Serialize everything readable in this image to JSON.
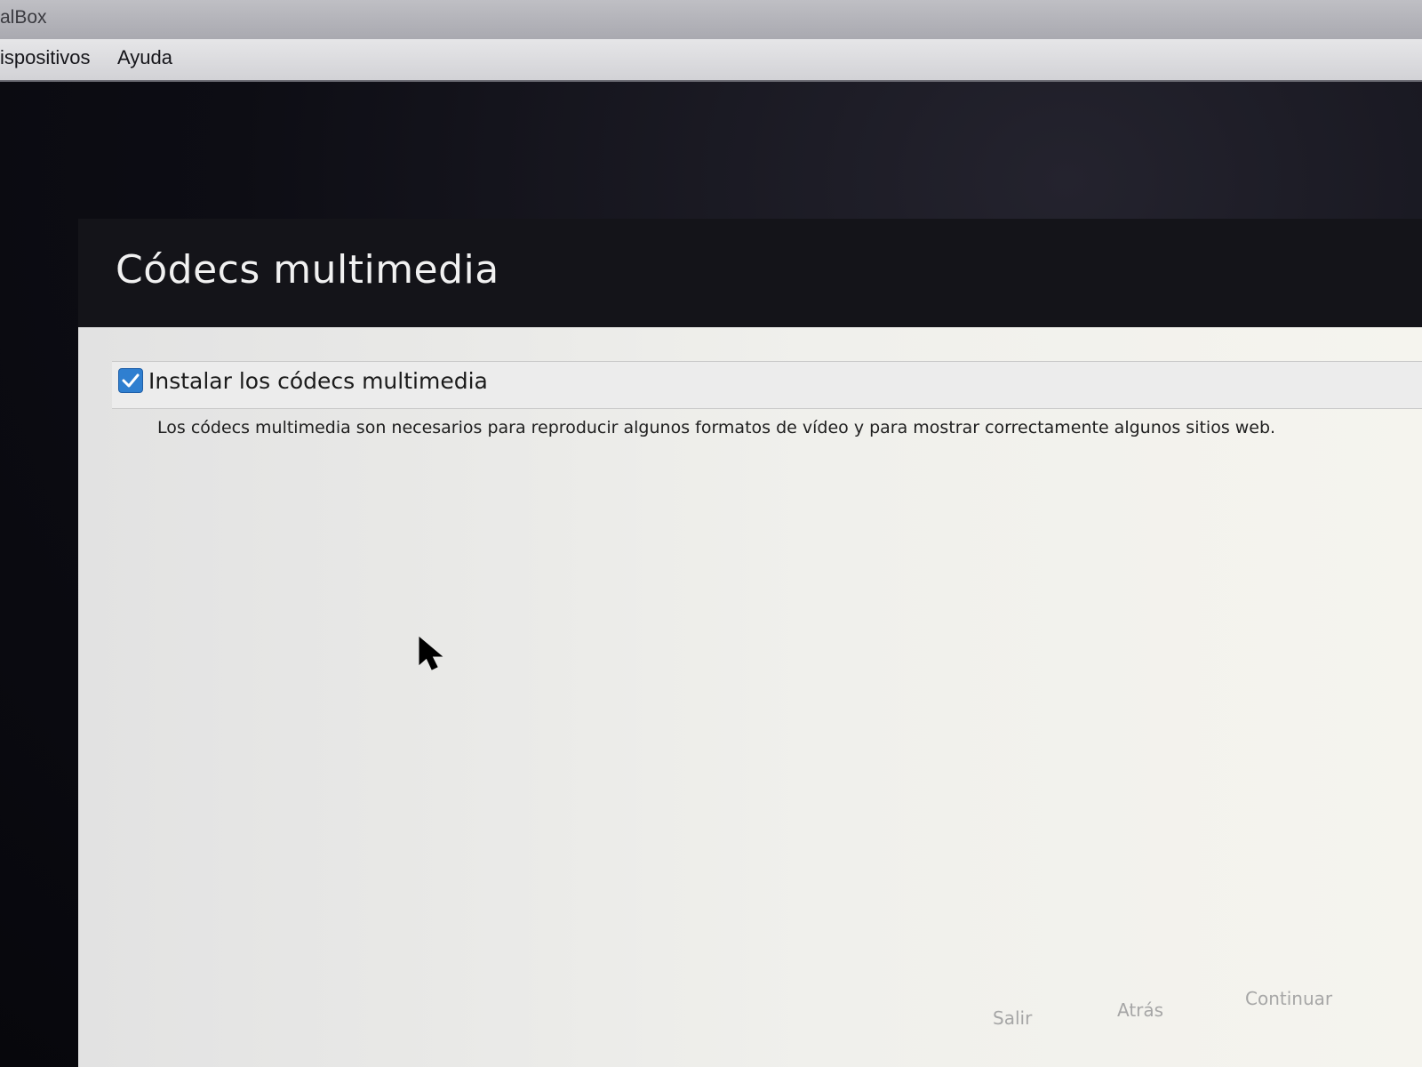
{
  "host_window": {
    "title": "alBox",
    "menu": [
      "ispositivos",
      "Ayuda"
    ]
  },
  "installer": {
    "title": "Códecs multimedia",
    "option": {
      "label": "Instalar los códecs multimedia",
      "checked": true
    },
    "description": "Los códecs multimedia son necesarios para reproducir algunos formatos de vídeo y para mostrar correctamente algunos sitios web.",
    "buttons": {
      "quit": "Salir",
      "back": "Atrás",
      "continue": "Continuar"
    }
  },
  "icons": {
    "checkbox": "check-icon",
    "cursor": "mouse-pointer-icon"
  },
  "colors": {
    "accent": "#2f7fd0",
    "panel": "#efefeb",
    "header": "#141419"
  }
}
